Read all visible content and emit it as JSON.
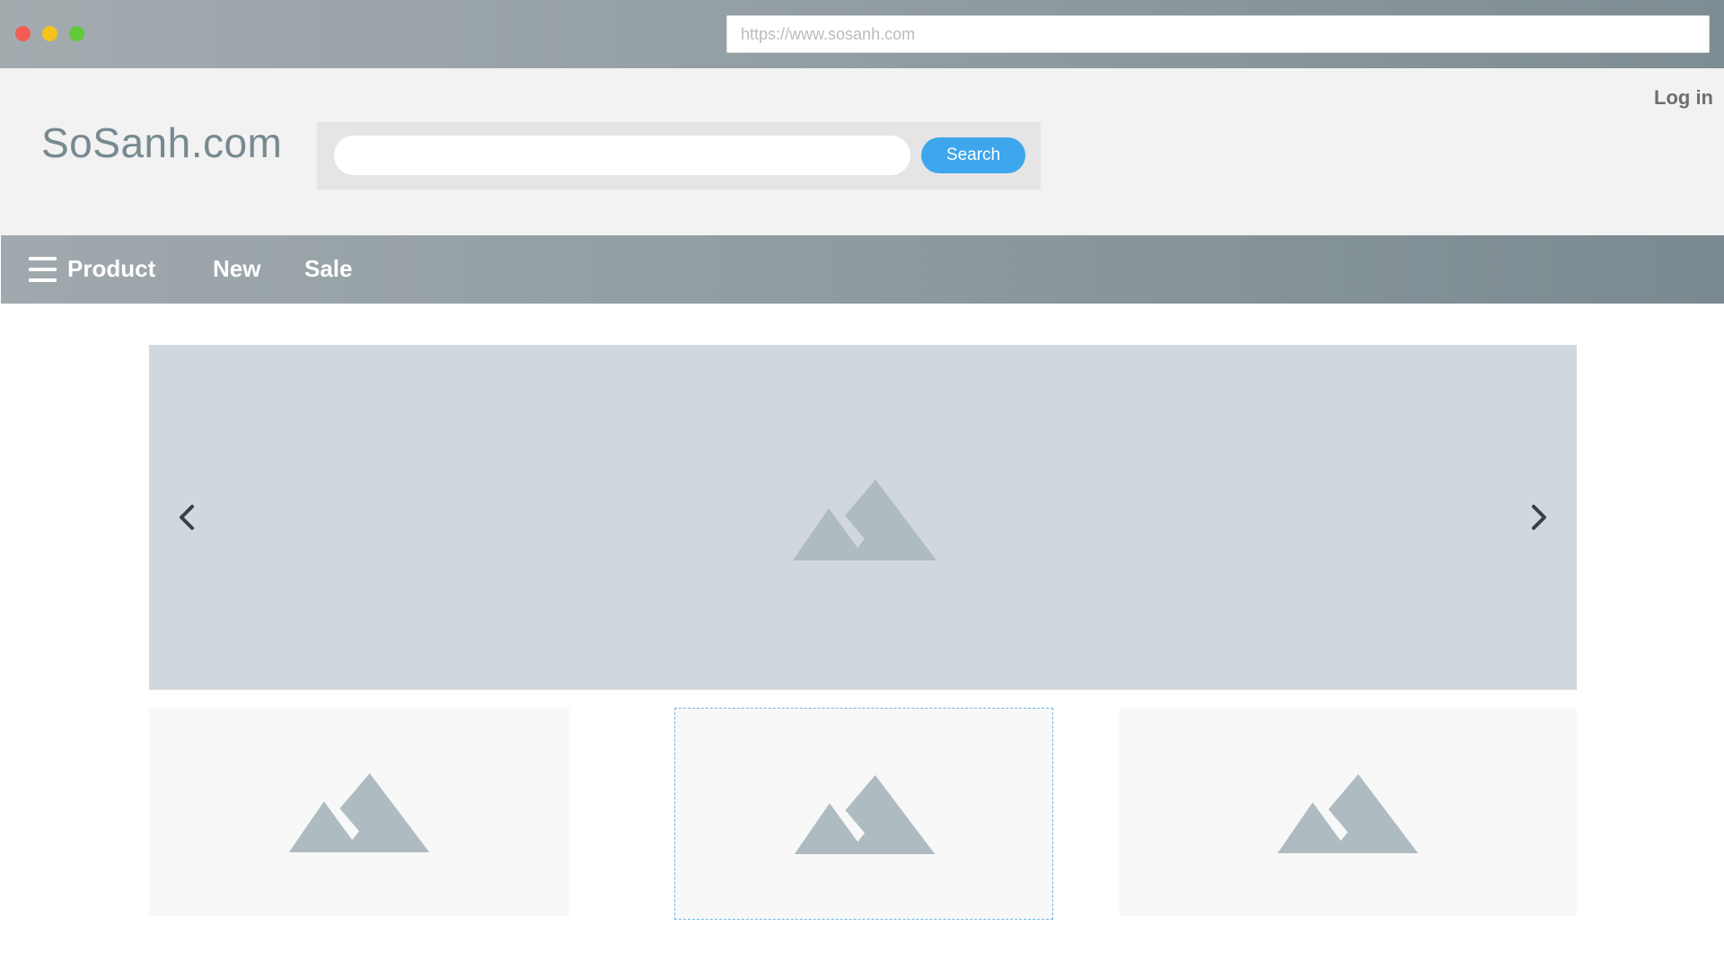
{
  "browser": {
    "url": "https://www.sosanh.com",
    "colors": {
      "close": "#f25c54",
      "minimize": "#f7c21c",
      "maximize": "#61c93a"
    }
  },
  "header": {
    "logo": "SoSanh.com",
    "login_label": "Log in",
    "search": {
      "placeholder": "",
      "button_label": "Search",
      "button_color": "#3da6ec"
    }
  },
  "nav": {
    "menu_icon": "hamburger-icon",
    "items": [
      {
        "label": "Product"
      },
      {
        "label": "New"
      },
      {
        "label": "Sale"
      }
    ]
  },
  "carousel": {
    "prev_icon": "chevron-left-icon",
    "next_icon": "chevron-right-icon",
    "image_icon": "image-placeholder-icon"
  },
  "thumbnails": [
    {
      "icon": "image-placeholder-icon",
      "selected": false
    },
    {
      "icon": "image-placeholder-icon",
      "selected": true
    },
    {
      "icon": "image-placeholder-icon",
      "selected": false
    }
  ]
}
